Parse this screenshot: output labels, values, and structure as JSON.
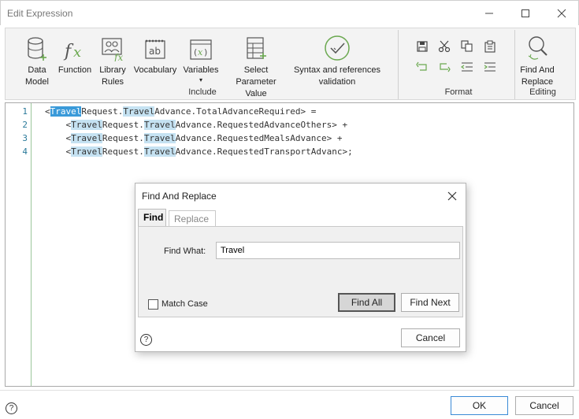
{
  "window": {
    "title": "Edit Expression"
  },
  "ribbon": {
    "insert_buttons": [
      {
        "label_1": "Data",
        "label_2": "Model",
        "icon": "database-icon"
      },
      {
        "label_1": "Function",
        "label_2": "",
        "icon": "function-icon"
      },
      {
        "label_1": "Library",
        "label_2": "Rules",
        "icon": "library-rules-icon"
      },
      {
        "label_1": "Vocabulary",
        "label_2": "",
        "icon": "vocabulary-icon"
      },
      {
        "label_1": "Variables",
        "label_2": "▾",
        "icon": "variables-icon"
      },
      {
        "label_1": "Select Parameter",
        "label_2": "Value",
        "icon": "parameter-icon"
      },
      {
        "label_1": "Syntax and references",
        "label_2": "validation",
        "icon": "validation-icon"
      }
    ],
    "groups": {
      "include": "Include",
      "format": "Format",
      "editing": "Editing"
    },
    "find_replace": {
      "label_1": "Find And",
      "label_2": "Replace"
    }
  },
  "editor": {
    "line_numbers": [
      "1",
      "2",
      "3",
      "4"
    ],
    "lines": [
      {
        "pre": "<",
        "t1": "Travel",
        "m1": "Request.",
        "t2": "Travel",
        "rest": "Advance.TotalAdvanceRequired> ="
      },
      {
        "pre": "    <",
        "t1": "Travel",
        "m1": "Request.",
        "t2": "Travel",
        "rest": "Advance.RequestedAdvanceOthers> +"
      },
      {
        "pre": "    <",
        "t1": "Travel",
        "m1": "Request.",
        "t2": "Travel",
        "rest": "Advance.RequestedMealsAdvance> +"
      },
      {
        "pre": "    <",
        "t1": "Travel",
        "m1": "Request.",
        "t2": "Travel",
        "rest": "Advance.RequestedTransportAdvanc>;"
      }
    ]
  },
  "dialog": {
    "title": "Find And Replace",
    "tabs": {
      "find": "Find",
      "replace": "Replace"
    },
    "find_what_label": "Find What:",
    "find_what_value": "Travel",
    "match_case_label": "Match Case",
    "find_all": "Find All",
    "find_next": "Find Next",
    "cancel": "Cancel",
    "help": "?"
  },
  "footer": {
    "ok": "OK",
    "cancel": "Cancel",
    "help": "?"
  },
  "colors": {
    "highlight": "#c5e2f2",
    "selection": "#3a9ad9",
    "accent_green": "#6aa84f"
  }
}
